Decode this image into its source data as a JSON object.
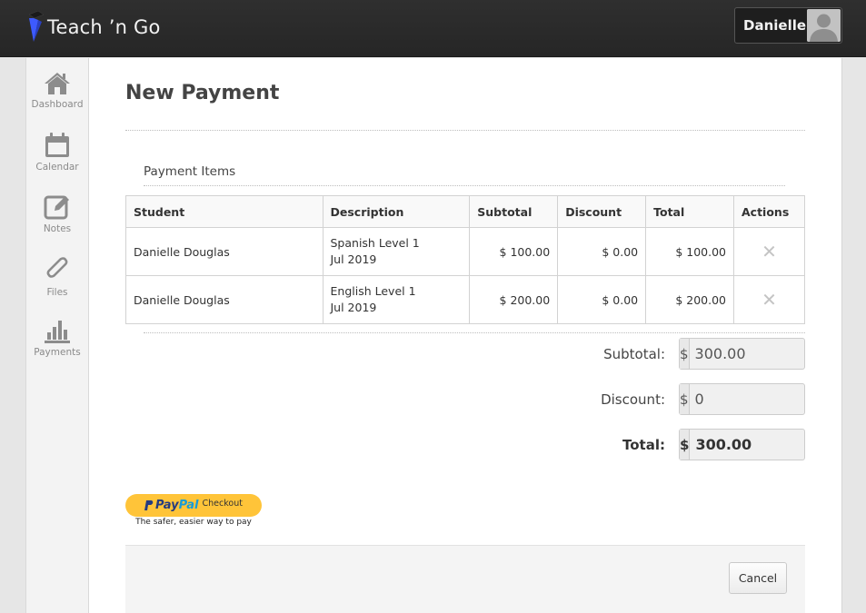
{
  "app": {
    "brand": "Teach ’n Go",
    "logo_icon": "teach-n-go-logo",
    "user_name": "Danielle",
    "avatar_icon": "user-avatar-placeholder"
  },
  "sidebar": {
    "items": [
      {
        "label": "Dashboard",
        "icon": "home-icon"
      },
      {
        "label": "Calendar",
        "icon": "calendar-icon"
      },
      {
        "label": "Notes",
        "icon": "edit-note-icon"
      },
      {
        "label": "Files",
        "icon": "paperclip-icon"
      },
      {
        "label": "Payments",
        "icon": "bar-chart-icon"
      }
    ]
  },
  "page": {
    "title": "New Payment",
    "section_title": "Payment Items"
  },
  "table": {
    "headers": {
      "student": "Student",
      "description": "Description",
      "subtotal": "Subtotal",
      "discount": "Discount",
      "total": "Total",
      "actions": "Actions"
    },
    "rows": [
      {
        "student": "Danielle Douglas",
        "desc_line1": "Spanish Level 1",
        "desc_line2": "Jul 2019",
        "subtotal": "$ 100.00",
        "discount": "$ 0.00",
        "total": "$ 100.00",
        "action": "✕"
      },
      {
        "student": "Danielle Douglas",
        "desc_line1": "English Level 1",
        "desc_line2": "Jul 2019",
        "subtotal": "$ 200.00",
        "discount": "$ 0.00",
        "total": "$ 200.00",
        "action": "✕"
      }
    ]
  },
  "summary": {
    "currency": "$",
    "subtotal_label": "Subtotal:",
    "subtotal_value": "300.00",
    "discount_label": "Discount:",
    "discount_value": "0",
    "total_label": "Total:",
    "total_value": "300.00"
  },
  "paypal": {
    "brand_pay": "Pay",
    "brand_pal": "Pal",
    "checkout": "Checkout",
    "tagline": "The safer, easier way to pay",
    "colors": {
      "button": "#ffc439",
      "dark_blue": "#253b80",
      "light_blue": "#179bd7"
    }
  },
  "footer": {
    "cancel_label": "Cancel"
  },
  "colors": {
    "topbar": "#2a2a2a",
    "logo_accent": "#3d5afe",
    "sidebar_icon": "#8c8c8c"
  }
}
